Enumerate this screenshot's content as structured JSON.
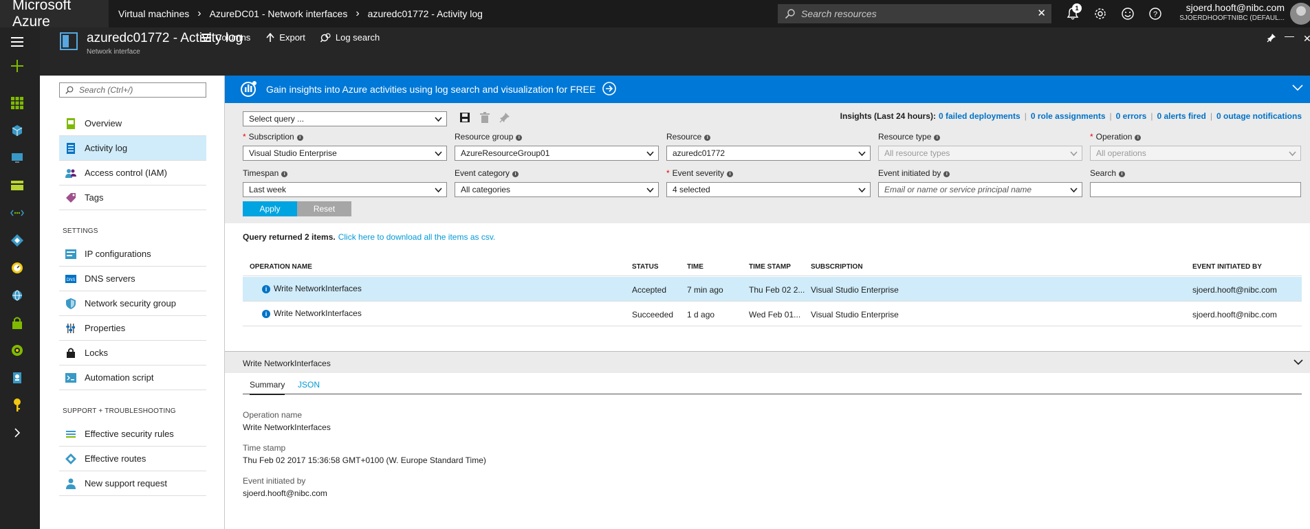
{
  "topbar": {
    "brand": "Microsoft Azure",
    "breadcrumbs": [
      "Virtual machines",
      "AzureDC01 - Network interfaces",
      "azuredc01772 - Activity log"
    ],
    "search_placeholder": "Search resources",
    "notification_count": "1",
    "user_email": "sjoerd.hooft@nibc.com",
    "user_tenant": "SJOERDHOOFTNIBC (DEFAUL..."
  },
  "blade": {
    "title": "azuredc01772 - Activity log",
    "subtitle": "Network interface",
    "commands": [
      "Columns",
      "Export",
      "Log search"
    ]
  },
  "menu": {
    "search_placeholder": "Search (Ctrl+/)",
    "items": [
      "Overview",
      "Activity log",
      "Access control (IAM)",
      "Tags"
    ],
    "settings_heading": "SETTINGS",
    "settings_items": [
      "IP configurations",
      "DNS servers",
      "Network security group",
      "Properties",
      "Locks",
      "Automation script"
    ],
    "support_heading": "SUPPORT + TROUBLESHOOTING",
    "support_items": [
      "Effective security rules",
      "Effective routes",
      "New support request"
    ]
  },
  "banner": {
    "text": "Gain insights into Azure activities using log search and visualization for FREE"
  },
  "filters": {
    "select_query": "Select query ...",
    "insights_label": "Insights (Last 24 hours):",
    "insights_links": [
      "0 failed deployments",
      "0 role assignments",
      "0 errors",
      "0 alerts fired",
      "0 outage notifications"
    ],
    "subscription_label": "Subscription",
    "subscription_value": "Visual Studio Enterprise",
    "resource_group_label": "Resource group",
    "resource_group_value": "AzureResourceGroup01",
    "resource_label": "Resource",
    "resource_value": "azuredc01772",
    "resource_type_label": "Resource type",
    "resource_type_value": "All resource types",
    "operation_label": "Operation",
    "operation_value": "All operations",
    "timespan_label": "Timespan",
    "timespan_value": "Last week",
    "event_category_label": "Event category",
    "event_category_value": "All categories",
    "event_severity_label": "Event severity",
    "event_severity_value": "4 selected",
    "event_initiated_label": "Event initiated by",
    "event_initiated_placeholder": "Email or name or service principal name",
    "search_label": "Search",
    "apply": "Apply",
    "reset": "Reset"
  },
  "results": {
    "summary": "Query returned 2 items.",
    "download_link": "Click here to download all the items as csv.",
    "columns": [
      "OPERATION NAME",
      "STATUS",
      "TIME",
      "TIME STAMP",
      "SUBSCRIPTION",
      "EVENT INITIATED BY"
    ],
    "rows": [
      {
        "operation": "Write NetworkInterfaces",
        "status": "Accepted",
        "time": "7 min ago",
        "timestamp": "Thu Feb 02 2...",
        "subscription": "Visual Studio Enterprise",
        "initiated_by": "sjoerd.hooft@nibc.com"
      },
      {
        "operation": "Write NetworkInterfaces",
        "status": "Succeeded",
        "time": "1 d ago",
        "timestamp": "Wed Feb 01...",
        "subscription": "Visual Studio Enterprise",
        "initiated_by": "sjoerd.hooft@nibc.com"
      }
    ]
  },
  "detail": {
    "title": "Write NetworkInterfaces",
    "tabs": [
      "Summary",
      "JSON"
    ],
    "operation_name_label": "Operation name",
    "operation_name": "Write NetworkInterfaces",
    "timestamp_label": "Time stamp",
    "timestamp": "Thu Feb 02 2017 15:36:58 GMT+0100 (W. Europe Standard Time)",
    "initiated_label": "Event initiated by",
    "initiated_by": "sjoerd.hooft@nibc.com"
  },
  "colors": {
    "accent": "#0078d7",
    "selected_row": "#d0ecfa",
    "apply": "#00a4e0",
    "link": "#0072c6"
  }
}
